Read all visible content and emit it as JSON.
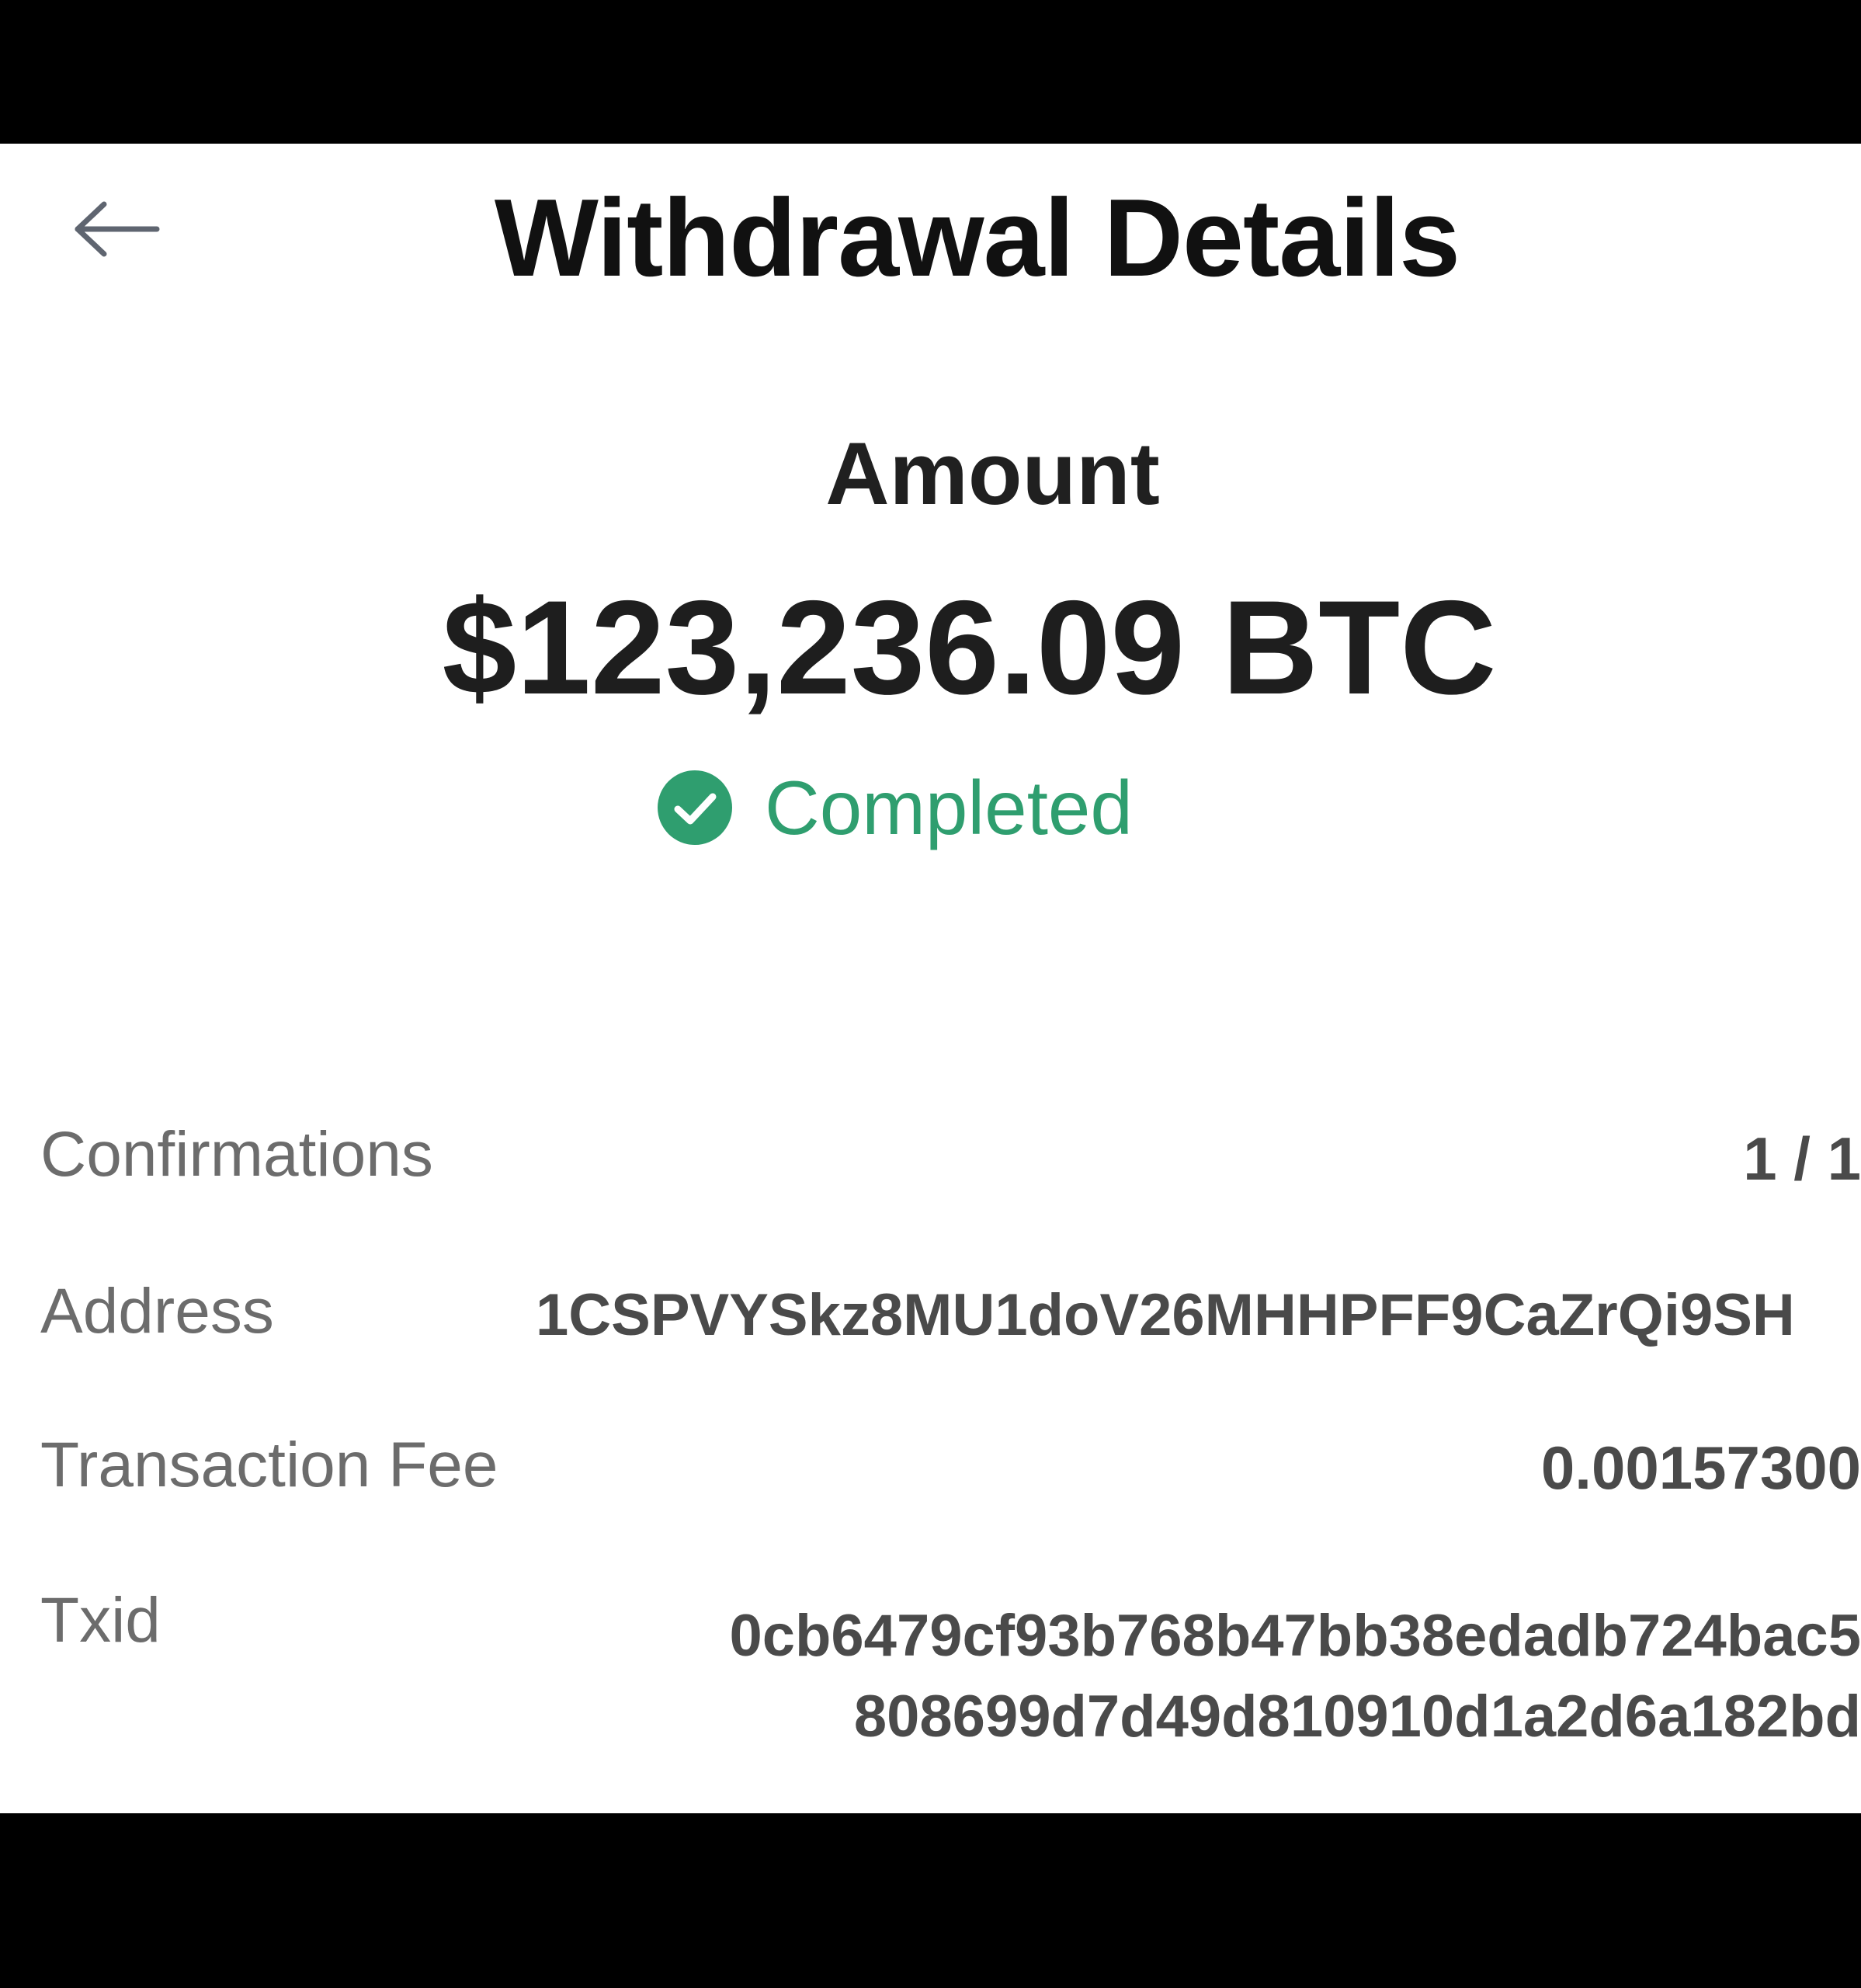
{
  "header": {
    "back_icon": "arrow-left-icon",
    "title": "Withdrawal Details"
  },
  "summary": {
    "amount_label": "Amount",
    "amount_value": "$123,236.09 BTC",
    "status_icon": "check-circle-icon",
    "status_text": "Completed",
    "status_color": "#2f9e6f"
  },
  "details": {
    "confirmations": {
      "label": "Confirmations",
      "value": "1 / 1"
    },
    "address": {
      "label": "Address",
      "value": "1CSPVYSkz8MU1doV26MHHPFF9CaZrQi9SH"
    },
    "fee": {
      "label": "Transaction Fee",
      "value": "0.00157300"
    },
    "txid": {
      "label": "Txid",
      "line1": "0cb6479cf93b768b47bb38edadb724bac5",
      "line2": "808699d7d49d810910d1a2d6a182bd"
    }
  }
}
